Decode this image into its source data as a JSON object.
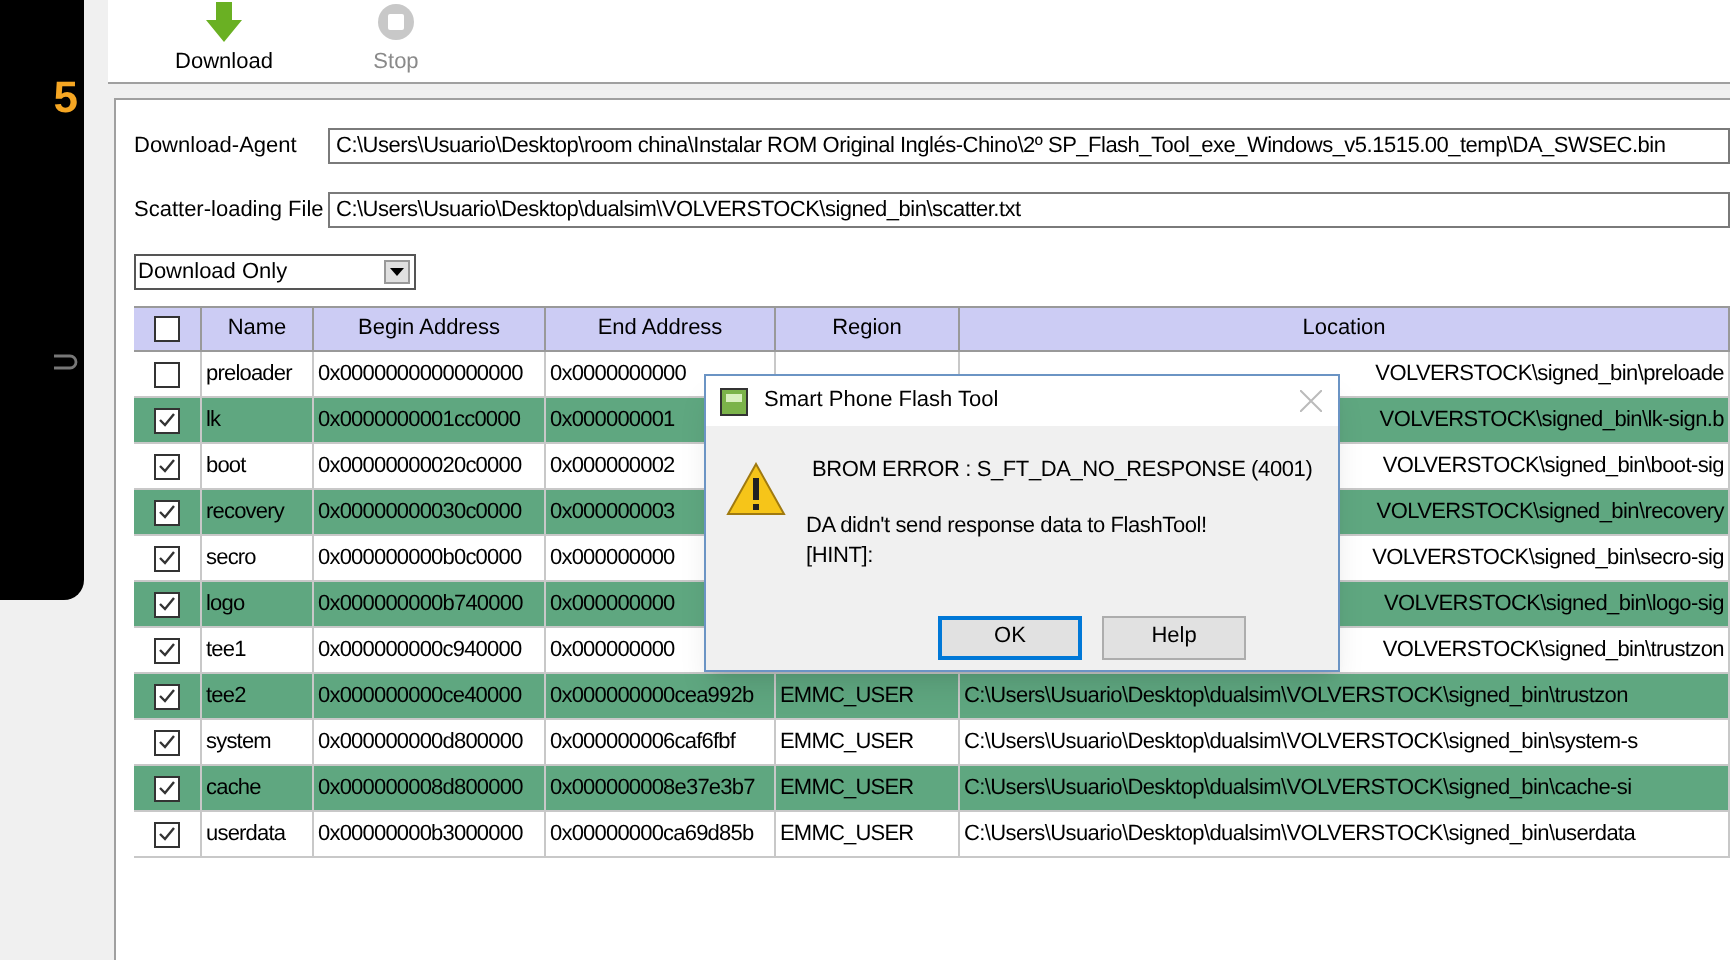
{
  "phone": {
    "screen_text": "5"
  },
  "toolbar": [
    {
      "kind": "download",
      "label": "Download",
      "disabled": false
    },
    {
      "kind": "stop",
      "label": "Stop",
      "disabled": true
    }
  ],
  "download_agent": {
    "label": "Download-Agent",
    "value": "C:\\Users\\Usuario\\Desktop\\room china\\Instalar ROM Original Inglés-Chino\\2º SP_Flash_Tool_exe_Windows_v5.1515.00_temp\\DA_SWSEC.bin"
  },
  "scatter_file": {
    "label": "Scatter-loading File",
    "value": "C:\\Users\\Usuario\\Desktop\\dualsim\\VOLVERSTOCK\\signed_bin\\scatter.txt"
  },
  "mode_select": {
    "value": "Download Only"
  },
  "table": {
    "header_checked": false,
    "columns": [
      "Name",
      "Begin Address",
      "End Address",
      "Region",
      "Location"
    ],
    "rows": [
      {
        "checked": false,
        "covered": true,
        "name": "preloader",
        "begin": "0x0000000000000000",
        "end": "0x0000000000",
        "location": "VOLVERSTOCK\\signed_bin\\preloade"
      },
      {
        "checked": true,
        "covered": true,
        "name": "lk",
        "begin": "0x0000000001cc0000",
        "end": "0x000000001",
        "location": "VOLVERSTOCK\\signed_bin\\lk-sign.b"
      },
      {
        "checked": true,
        "covered": true,
        "name": "boot",
        "begin": "0x00000000020c0000",
        "end": "0x000000002",
        "location": "VOLVERSTOCK\\signed_bin\\boot-sig"
      },
      {
        "checked": true,
        "covered": true,
        "name": "recovery",
        "begin": "0x00000000030c0000",
        "end": "0x000000003",
        "location": "VOLVERSTOCK\\signed_bin\\recovery"
      },
      {
        "checked": true,
        "covered": true,
        "name": "secro",
        "begin": "0x000000000b0c0000",
        "end": "0x000000000",
        "location": "VOLVERSTOCK\\signed_bin\\secro-sig"
      },
      {
        "checked": true,
        "covered": true,
        "name": "logo",
        "begin": "0x000000000b740000",
        "end": "0x000000000",
        "location": "VOLVERSTOCK\\signed_bin\\logo-sig"
      },
      {
        "checked": true,
        "covered": true,
        "name": "tee1",
        "begin": "0x000000000c940000",
        "end": "0x000000000",
        "location": "VOLVERSTOCK\\signed_bin\\trustzon"
      },
      {
        "checked": true,
        "covered": false,
        "name": "tee2",
        "begin": "0x000000000ce40000",
        "end": "0x000000000cea992b",
        "region": "EMMC_USER",
        "location": "C:\\Users\\Usuario\\Desktop\\dualsim\\VOLVERSTOCK\\signed_bin\\trustzon"
      },
      {
        "checked": true,
        "covered": false,
        "name": "system",
        "begin": "0x000000000d800000",
        "end": "0x000000006caf6fbf",
        "region": "EMMC_USER",
        "location": "C:\\Users\\Usuario\\Desktop\\dualsim\\VOLVERSTOCK\\signed_bin\\system-s"
      },
      {
        "checked": true,
        "covered": false,
        "name": "cache",
        "begin": "0x000000008d800000",
        "end": "0x000000008e37e3b7",
        "region": "EMMC_USER",
        "location": "C:\\Users\\Usuario\\Desktop\\dualsim\\VOLVERSTOCK\\signed_bin\\cache-si"
      },
      {
        "checked": true,
        "covered": false,
        "name": "userdata",
        "begin": "0x00000000b3000000",
        "end": "0x00000000ca69d85b",
        "region": "EMMC_USER",
        "location": "C:\\Users\\Usuario\\Desktop\\dualsim\\VOLVERSTOCK\\signed_bin\\userdata"
      }
    ]
  },
  "dialog": {
    "title": "Smart Phone Flash Tool",
    "error": "BROM ERROR : S_FT_DA_NO_RESPONSE (4001)",
    "message": [
      "DA didn't send response data to FlashTool!",
      "[HINT]:"
    ],
    "buttons": [
      {
        "label": "OK",
        "selected": true
      },
      {
        "label": "Help",
        "selected": false
      }
    ]
  }
}
